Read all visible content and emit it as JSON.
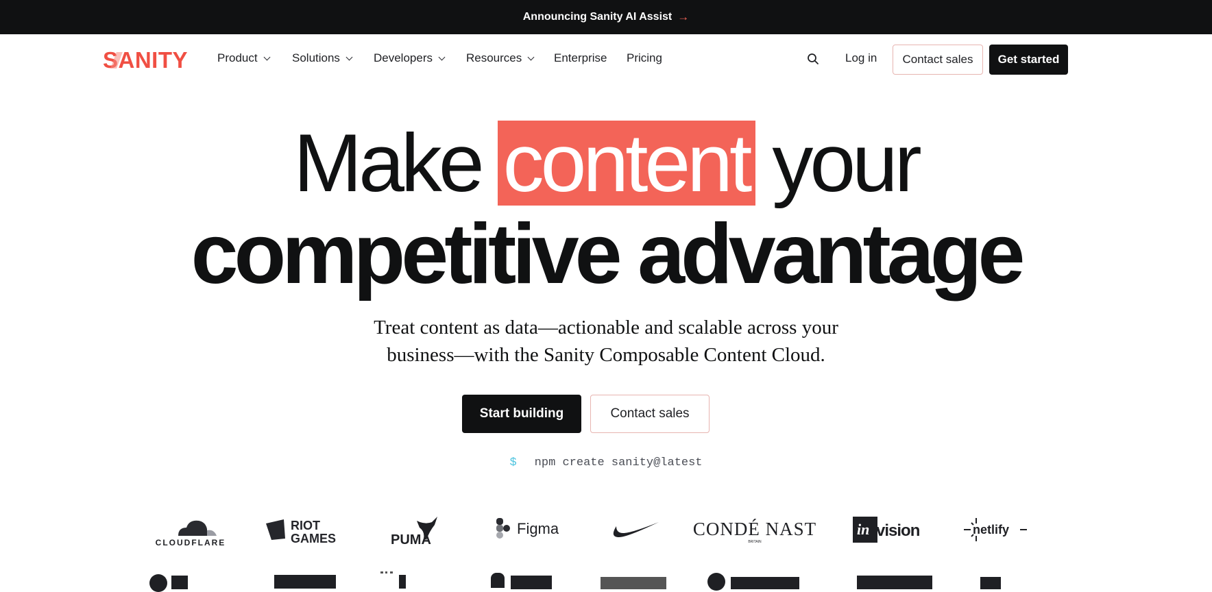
{
  "announcement": {
    "text": "Announcing Sanity AI Assist",
    "icon": "arrow-right-icon"
  },
  "nav": {
    "logo": "SANITY",
    "items": [
      {
        "label": "Product",
        "has_dropdown": true
      },
      {
        "label": "Solutions",
        "has_dropdown": true
      },
      {
        "label": "Developers",
        "has_dropdown": true
      },
      {
        "label": "Resources",
        "has_dropdown": true
      },
      {
        "label": "Enterprise",
        "has_dropdown": false
      },
      {
        "label": "Pricing",
        "has_dropdown": false
      }
    ],
    "search_icon": "search-icon",
    "login": "Log in",
    "contact_sales": "Contact sales",
    "get_started": "Get started"
  },
  "hero": {
    "line1_before": "Make",
    "line1_highlight": "content",
    "line1_after": "your",
    "line2": "competitive advantage",
    "subtitle_line1": "Treat content as data—actionable and scalable across your",
    "subtitle_line2": "business—with the Sanity Composable Content Cloud.",
    "primary_cta": "Start building",
    "secondary_cta": "Contact sales",
    "npm_prompt": "$",
    "npm_command": "npm create sanity@latest"
  },
  "logos": {
    "row1": [
      "CLOUDFLARE",
      "RIOT GAMES",
      "PUMA",
      "Figma",
      "Nike",
      "CONDÉ NAST",
      "InVision",
      "netlify"
    ],
    "condenast_sub": "BRITAIN"
  },
  "colors": {
    "brand_red": "#f36458",
    "dark": "#101112",
    "prompt_cyan": "#4ec4df",
    "outline_border": "#e7b4b0"
  }
}
